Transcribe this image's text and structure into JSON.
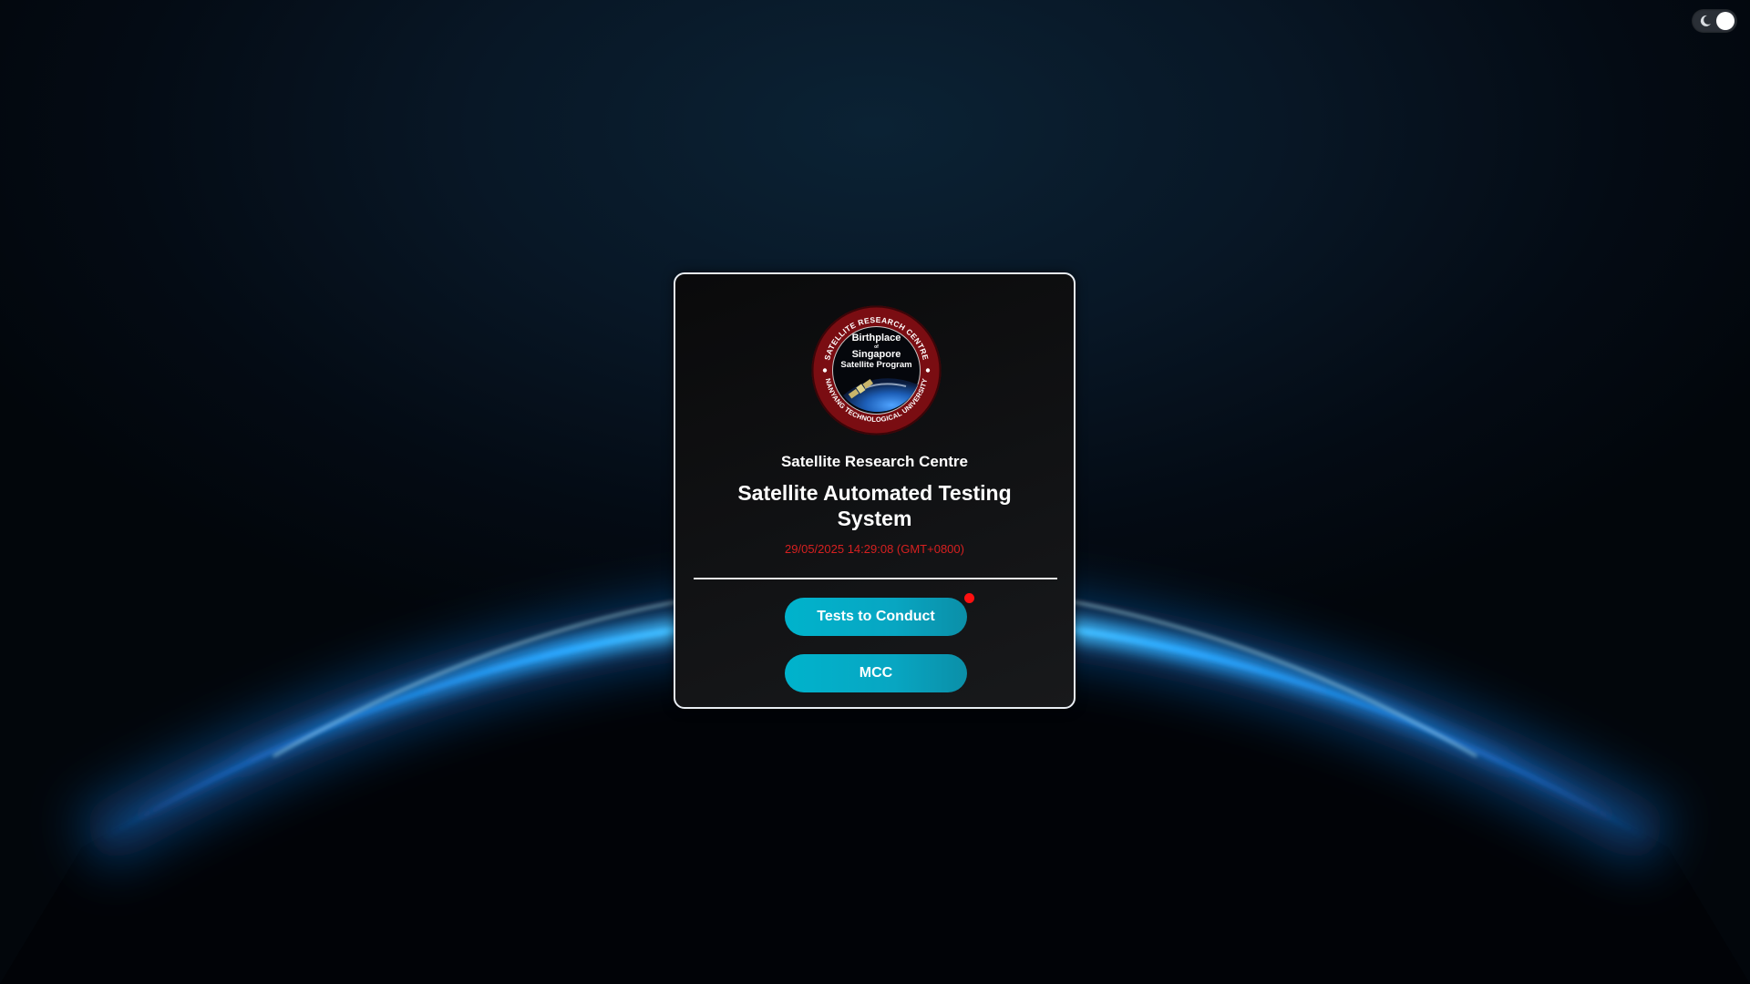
{
  "header": {
    "theme_toggle": {
      "icon": "moon-icon",
      "state": "dark"
    }
  },
  "card": {
    "logo": {
      "ring_top_text": "SATELLITE RESEARCH CENTRE",
      "ring_bottom_text": "NANYANG TECHNOLOGICAL UNIVERSITY",
      "center_line_1": "Birthplace",
      "center_line_2": "of",
      "center_line_3": "Singapore",
      "center_line_4": "Satellite Program"
    },
    "org_name": "Satellite Research Centre",
    "app_title": "Satellite Automated Testing System",
    "datetime": "29/05/2025 14:29:08 (GMT+0800)",
    "buttons": {
      "tests_label": "Tests to Conduct",
      "mcc_label": "MCC"
    },
    "notification": {
      "color": "#ff1010"
    }
  },
  "colors": {
    "accent": "#00b3cc",
    "datetime": "#d62020",
    "background": "#040b14"
  }
}
